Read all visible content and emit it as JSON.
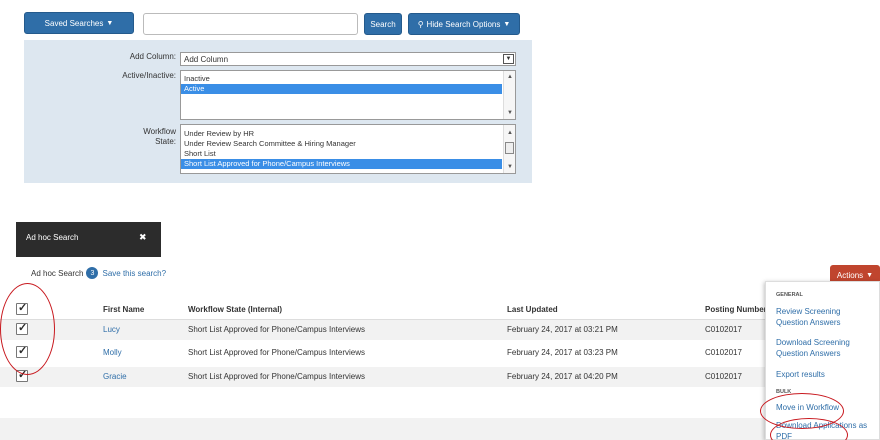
{
  "toolbar": {
    "saved_searches_label": "Saved Searches",
    "search_value": "",
    "search_button_label": "Search",
    "hide_options_label": "Hide Search Options"
  },
  "filters": {
    "add_column_label": "Add Column:",
    "add_column_value": "Add Column",
    "active_label": "Active/Inactive:",
    "active_options": [
      {
        "label": "Inactive",
        "selected": false
      },
      {
        "label": "Active",
        "selected": true
      }
    ],
    "workflow_label_line1": "Workflow",
    "workflow_label_line2": "State:",
    "workflow_options": [
      {
        "label": "Under Review by HR",
        "selected": false
      },
      {
        "label": "Under Review Search Committee & Hiring Manager",
        "selected": false
      },
      {
        "label": "Short List",
        "selected": false
      },
      {
        "label": "Short List Approved for Phone/Campus Interviews",
        "selected": true
      }
    ]
  },
  "tab": {
    "title": "Ad hoc Search",
    "close_glyph": "✖"
  },
  "results": {
    "title": "Ad hoc Search",
    "count": "3",
    "save_link": "Save this search?",
    "actions_label": "Actions",
    "columns": [
      "First Name",
      "Workflow State (Internal)",
      "Last Updated",
      "Posting Number"
    ],
    "rows": [
      {
        "first_name": "Lucy",
        "workflow_state": "Short List Approved for Phone/Campus Interviews",
        "last_updated": "February 24, 2017 at 03:21 PM",
        "posting_number": "C0102017",
        "checked": true
      },
      {
        "first_name": "Molly",
        "workflow_state": "Short List Approved for Phone/Campus Interviews",
        "last_updated": "February 24, 2017 at 03:23 PM",
        "posting_number": "C0102017",
        "checked": true
      },
      {
        "first_name": "Gracie",
        "workflow_state": "Short List Approved for Phone/Campus Interviews",
        "last_updated": "February 24, 2017 at 04:20 PM",
        "posting_number": "C0102017",
        "checked": true
      }
    ]
  },
  "actions_menu": {
    "general_header": "GENERAL",
    "review_screening_line1": "Review Screening",
    "review_screening_line2": "Question Answers",
    "download_screening_line1": "Download Screening",
    "download_screening_line2": "Question Answers",
    "export_results": "Export results",
    "bulk_header": "BULK",
    "move_in_workflow": "Move in Workflow",
    "download_applications_line1": "Download Applications as",
    "download_applications_line2": "PDF"
  },
  "colors": {
    "primary_blue": "#2f6ea8",
    "panel_bg": "#dde7f0",
    "actions_red": "#c0452e",
    "annotation_red": "#c8191f",
    "selected_option": "#3a8ee6"
  }
}
